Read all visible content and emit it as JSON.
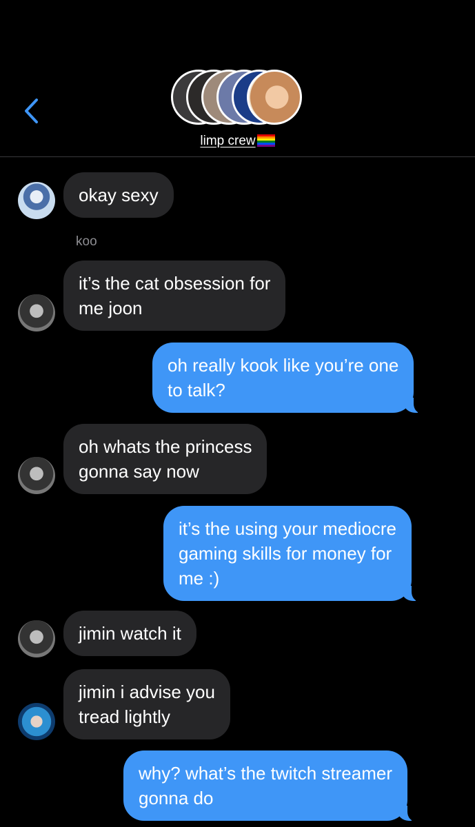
{
  "header": {
    "back_icon": "chevron-left-icon",
    "group_name": "limp crew",
    "group_emoji": "rainbow-flag-icon",
    "accent_color": "#3f96f7"
  },
  "messages": [
    {
      "side": "in",
      "text": "okay sexy"
    },
    {
      "side": "in",
      "sender": "koo",
      "text": "it’s the cat obsession for\nme joon"
    },
    {
      "side": "out",
      "text": "oh really kook like you’re one\nto talk?"
    },
    {
      "side": "in",
      "text": "oh whats the princess\ngonna say now"
    },
    {
      "side": "out",
      "text": "it’s the using your mediocre\ngaming skills for money for\nme :)"
    },
    {
      "side": "in",
      "text": "jimin watch it"
    },
    {
      "side": "in",
      "text": "jimin i advise you\ntread lightly"
    },
    {
      "side": "out",
      "text": "why? what’s the twitch streamer\ngonna do"
    }
  ]
}
